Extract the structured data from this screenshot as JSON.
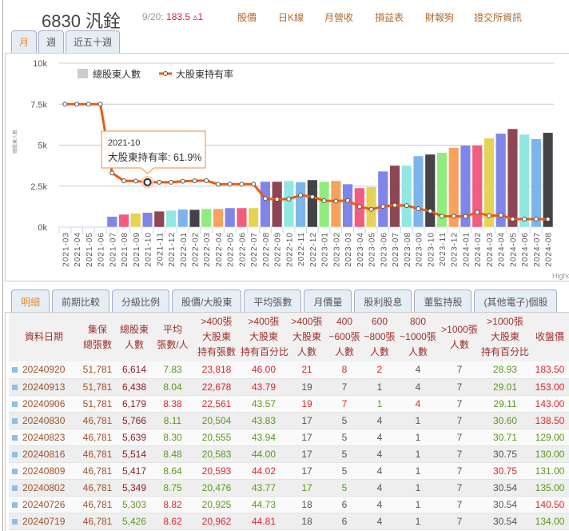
{
  "header": {
    "code_name": "6830 汎銓",
    "quote_date": "9/20:",
    "price": "183.5",
    "change": "▵1",
    "links": [
      "股價",
      "日K線",
      "月營收",
      "損益表",
      "財報狗",
      "證交所資訊"
    ]
  },
  "period_tabs": [
    "月",
    "週",
    "近五十週"
  ],
  "chart_data": {
    "type": "bar+line",
    "y_axis_label": "總股東人數",
    "y_ticks": [
      "0k",
      "2.5k",
      "5k",
      "7.5k",
      "10k"
    ],
    "ylim": [
      0,
      10000
    ],
    "y2lim": [
      40,
      120
    ],
    "legend": [
      "總股東人數",
      "大股東持有率"
    ],
    "credit": "Highc",
    "categories": [
      "2021-03",
      "2021-04",
      "2021-05",
      "2021-06",
      "2021-07",
      "2021-08",
      "2021-09",
      "2021-10",
      "2021-11",
      "2021-12",
      "2022-01",
      "2022-02",
      "2022-03",
      "2022-04",
      "2022-05",
      "2022-06",
      "2022-07",
      "2022-08",
      "2022-09",
      "2022-10",
      "2022-11",
      "2022-12",
      "2023-01",
      "2023-02",
      "2023-03",
      "2023-04",
      "2023-05",
      "2023-06",
      "2023-07",
      "2023-08",
      "2023-09",
      "2023-10",
      "2023-11",
      "2023-12",
      "2024-01",
      "2024-02",
      "2024-03",
      "2024-04",
      "2024-05",
      "2024-06",
      "2024-07",
      "2024-08"
    ],
    "series": [
      {
        "name": "總股東人數",
        "type": "bar",
        "values": [
          null,
          null,
          null,
          null,
          650,
          780,
          840,
          890,
          970,
          1020,
          1090,
          1070,
          1120,
          1120,
          1170,
          1170,
          1170,
          2780,
          2780,
          2830,
          2750,
          2880,
          2780,
          2830,
          2630,
          2390,
          2450,
          3410,
          3760,
          3760,
          4340,
          4440,
          4550,
          4850,
          4990,
          4990,
          5430,
          5710,
          6000,
          5660,
          5380,
          5766
        ]
      },
      {
        "name": "大股東持有率",
        "type": "line",
        "values": [
          100,
          100,
          100,
          100,
          66.4,
          62.6,
          62.5,
          61.9,
          61.9,
          61.9,
          62.4,
          62.6,
          62.7,
          60.9,
          61.0,
          61.0,
          61.0,
          53.9,
          53.6,
          53.7,
          55.6,
          54.8,
          52.9,
          52.7,
          53.0,
          50.0,
          48.7,
          50.1,
          50.7,
          50.5,
          49.0,
          47.8,
          45.3,
          45.3,
          45.2,
          47.2,
          45.5,
          45.8,
          43.9,
          43.9,
          43.9,
          43.83
        ]
      }
    ],
    "bar_colors": [
      "#7cb5ec",
      "#434348",
      "#90ed7d",
      "#f7a35c",
      "#8085e9",
      "#f15c80",
      "#e4d354",
      "#8085e8",
      "#8d4654",
      "#91e8e1"
    ],
    "line_color": "#f15a0a",
    "tooltip": {
      "category": "2021-10",
      "label": "大股東持有率: 61.9%"
    }
  },
  "table_tabs": [
    "明細",
    "前期比較",
    "分級比例",
    "股價/大股東",
    "平均張數",
    "月價量",
    "股利股息",
    "董監持股",
    "(其他電子)個股"
  ],
  "table": {
    "headers": [
      [
        "資料日期"
      ],
      [
        "集保",
        "總張數"
      ],
      [
        "總股東",
        "人數"
      ],
      [
        "平均",
        "張數/人"
      ],
      [
        ">400張",
        "大股東",
        "持有張數"
      ],
      [
        ">400張",
        "大股東",
        "持有百分比"
      ],
      [
        ">400張",
        "大股東",
        "人數"
      ],
      [
        "400",
        "~600張",
        "人數"
      ],
      [
        "600",
        "~800張",
        "人數"
      ],
      [
        "800",
        "~1000張",
        "人數"
      ],
      [
        ">1000張",
        "人數"
      ],
      [
        ">1000張",
        "大股東",
        "持有百分比"
      ],
      [
        "收盤價"
      ]
    ],
    "rows": [
      {
        "cells": [
          "20240920",
          "51,781",
          "6,614",
          "7.83",
          "23,818",
          "46.00",
          "21",
          "8",
          "2",
          "4",
          "7",
          "28.93",
          "183.50"
        ],
        "colors": [
          "b",
          "b",
          "d",
          "g",
          "r",
          "r",
          "r",
          "r",
          "r",
          "n",
          "n",
          "g",
          "r"
        ]
      },
      {
        "cells": [
          "20240913",
          "51,781",
          "6,438",
          "8.04",
          "22,678",
          "43.79",
          "19",
          "7",
          "1",
          "4",
          "7",
          "29.01",
          "153.00"
        ],
        "colors": [
          "b",
          "b",
          "d",
          "g",
          "r",
          "r",
          "n",
          "n",
          "n",
          "n",
          "n",
          "g",
          "r"
        ]
      },
      {
        "cells": [
          "20240906",
          "51,781",
          "6,179",
          "8.38",
          "22,561",
          "43.57",
          "19",
          "7",
          "1",
          "4",
          "7",
          "29.11",
          "143.00"
        ],
        "colors": [
          "b",
          "b",
          "d",
          "r",
          "r",
          "g",
          "r",
          "r",
          "g",
          "r",
          "n",
          "g",
          "r"
        ]
      },
      {
        "cells": [
          "20240830",
          "46,781",
          "5,766",
          "8.11",
          "20,504",
          "43.83",
          "17",
          "5",
          "4",
          "1",
          "7",
          "30.60",
          "138.50"
        ],
        "colors": [
          "b",
          "b",
          "d",
          "g",
          "g",
          "g",
          "n",
          "n",
          "n",
          "n",
          "n",
          "g",
          "r"
        ]
      },
      {
        "cells": [
          "20240823",
          "46,781",
          "5,639",
          "8.30",
          "20,555",
          "43.94",
          "17",
          "5",
          "4",
          "1",
          "7",
          "30.71",
          "129.00"
        ],
        "colors": [
          "b",
          "b",
          "d",
          "g",
          "g",
          "g",
          "n",
          "n",
          "n",
          "n",
          "n",
          "g",
          "g"
        ]
      },
      {
        "cells": [
          "20240816",
          "46,781",
          "5,514",
          "8.48",
          "20,583",
          "44.00",
          "17",
          "5",
          "4",
          "1",
          "7",
          "30.75",
          "130.00"
        ],
        "colors": [
          "b",
          "b",
          "d",
          "g",
          "g",
          "g",
          "n",
          "n",
          "n",
          "n",
          "n",
          "n",
          "g"
        ]
      },
      {
        "cells": [
          "20240809",
          "46,781",
          "5,417",
          "8.64",
          "20,593",
          "44.02",
          "17",
          "5",
          "4",
          "1",
          "7",
          "30.75",
          "131.00"
        ],
        "colors": [
          "b",
          "b",
          "d",
          "g",
          "r",
          "r",
          "n",
          "n",
          "n",
          "n",
          "n",
          "r",
          "g"
        ]
      },
      {
        "cells": [
          "20240802",
          "46,781",
          "5,349",
          "8.75",
          "20,476",
          "43.77",
          "17",
          "5",
          "4",
          "1",
          "7",
          "30.54",
          "135.00"
        ],
        "colors": [
          "b",
          "b",
          "d",
          "g",
          "g",
          "g",
          "g",
          "g",
          "n",
          "n",
          "n",
          "n",
          "g"
        ]
      },
      {
        "cells": [
          "20240726",
          "46,781",
          "5,303",
          "8.82",
          "20,925",
          "44.73",
          "18",
          "6",
          "4",
          "1",
          "7",
          "30.54",
          "140.50"
        ],
        "colors": [
          "b",
          "b",
          "g",
          "r",
          "g",
          "g",
          "n",
          "n",
          "n",
          "n",
          "n",
          "n",
          "r"
        ]
      },
      {
        "cells": [
          "20240719",
          "46,781",
          "5,426",
          "8.62",
          "20,962",
          "44.81",
          "18",
          "6",
          "4",
          "1",
          "7",
          "30.54",
          "134.00"
        ],
        "colors": [
          "b",
          "b",
          "g",
          "r",
          "r",
          "r",
          "n",
          "n",
          "n",
          "n",
          "n",
          "n",
          "g"
        ]
      }
    ]
  }
}
